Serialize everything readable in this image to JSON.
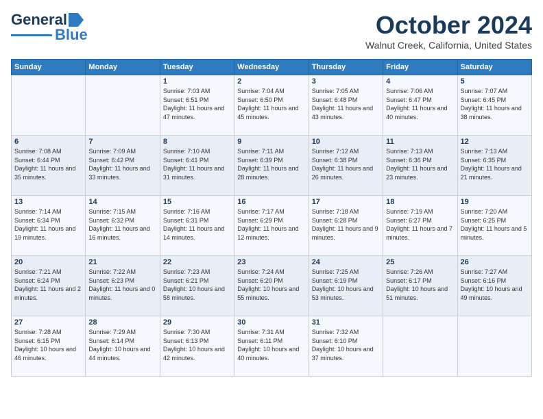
{
  "header": {
    "logo": {
      "line1": "General",
      "line2": "Blue"
    },
    "title": "October 2024",
    "location": "Walnut Creek, California, United States"
  },
  "days_of_week": [
    "Sunday",
    "Monday",
    "Tuesday",
    "Wednesday",
    "Thursday",
    "Friday",
    "Saturday"
  ],
  "weeks": [
    [
      {
        "day": "",
        "info": ""
      },
      {
        "day": "",
        "info": ""
      },
      {
        "day": "1",
        "info": "Sunrise: 7:03 AM\nSunset: 6:51 PM\nDaylight: 11 hours and 47 minutes."
      },
      {
        "day": "2",
        "info": "Sunrise: 7:04 AM\nSunset: 6:50 PM\nDaylight: 11 hours and 45 minutes."
      },
      {
        "day": "3",
        "info": "Sunrise: 7:05 AM\nSunset: 6:48 PM\nDaylight: 11 hours and 43 minutes."
      },
      {
        "day": "4",
        "info": "Sunrise: 7:06 AM\nSunset: 6:47 PM\nDaylight: 11 hours and 40 minutes."
      },
      {
        "day": "5",
        "info": "Sunrise: 7:07 AM\nSunset: 6:45 PM\nDaylight: 11 hours and 38 minutes."
      }
    ],
    [
      {
        "day": "6",
        "info": "Sunrise: 7:08 AM\nSunset: 6:44 PM\nDaylight: 11 hours and 35 minutes."
      },
      {
        "day": "7",
        "info": "Sunrise: 7:09 AM\nSunset: 6:42 PM\nDaylight: 11 hours and 33 minutes."
      },
      {
        "day": "8",
        "info": "Sunrise: 7:10 AM\nSunset: 6:41 PM\nDaylight: 11 hours and 31 minutes."
      },
      {
        "day": "9",
        "info": "Sunrise: 7:11 AM\nSunset: 6:39 PM\nDaylight: 11 hours and 28 minutes."
      },
      {
        "day": "10",
        "info": "Sunrise: 7:12 AM\nSunset: 6:38 PM\nDaylight: 11 hours and 26 minutes."
      },
      {
        "day": "11",
        "info": "Sunrise: 7:13 AM\nSunset: 6:36 PM\nDaylight: 11 hours and 23 minutes."
      },
      {
        "day": "12",
        "info": "Sunrise: 7:13 AM\nSunset: 6:35 PM\nDaylight: 11 hours and 21 minutes."
      }
    ],
    [
      {
        "day": "13",
        "info": "Sunrise: 7:14 AM\nSunset: 6:34 PM\nDaylight: 11 hours and 19 minutes."
      },
      {
        "day": "14",
        "info": "Sunrise: 7:15 AM\nSunset: 6:32 PM\nDaylight: 11 hours and 16 minutes."
      },
      {
        "day": "15",
        "info": "Sunrise: 7:16 AM\nSunset: 6:31 PM\nDaylight: 11 hours and 14 minutes."
      },
      {
        "day": "16",
        "info": "Sunrise: 7:17 AM\nSunset: 6:29 PM\nDaylight: 11 hours and 12 minutes."
      },
      {
        "day": "17",
        "info": "Sunrise: 7:18 AM\nSunset: 6:28 PM\nDaylight: 11 hours and 9 minutes."
      },
      {
        "day": "18",
        "info": "Sunrise: 7:19 AM\nSunset: 6:27 PM\nDaylight: 11 hours and 7 minutes."
      },
      {
        "day": "19",
        "info": "Sunrise: 7:20 AM\nSunset: 6:25 PM\nDaylight: 11 hours and 5 minutes."
      }
    ],
    [
      {
        "day": "20",
        "info": "Sunrise: 7:21 AM\nSunset: 6:24 PM\nDaylight: 11 hours and 2 minutes."
      },
      {
        "day": "21",
        "info": "Sunrise: 7:22 AM\nSunset: 6:23 PM\nDaylight: 11 hours and 0 minutes."
      },
      {
        "day": "22",
        "info": "Sunrise: 7:23 AM\nSunset: 6:21 PM\nDaylight: 10 hours and 58 minutes."
      },
      {
        "day": "23",
        "info": "Sunrise: 7:24 AM\nSunset: 6:20 PM\nDaylight: 10 hours and 55 minutes."
      },
      {
        "day": "24",
        "info": "Sunrise: 7:25 AM\nSunset: 6:19 PM\nDaylight: 10 hours and 53 minutes."
      },
      {
        "day": "25",
        "info": "Sunrise: 7:26 AM\nSunset: 6:17 PM\nDaylight: 10 hours and 51 minutes."
      },
      {
        "day": "26",
        "info": "Sunrise: 7:27 AM\nSunset: 6:16 PM\nDaylight: 10 hours and 49 minutes."
      }
    ],
    [
      {
        "day": "27",
        "info": "Sunrise: 7:28 AM\nSunset: 6:15 PM\nDaylight: 10 hours and 46 minutes."
      },
      {
        "day": "28",
        "info": "Sunrise: 7:29 AM\nSunset: 6:14 PM\nDaylight: 10 hours and 44 minutes."
      },
      {
        "day": "29",
        "info": "Sunrise: 7:30 AM\nSunset: 6:13 PM\nDaylight: 10 hours and 42 minutes."
      },
      {
        "day": "30",
        "info": "Sunrise: 7:31 AM\nSunset: 6:11 PM\nDaylight: 10 hours and 40 minutes."
      },
      {
        "day": "31",
        "info": "Sunrise: 7:32 AM\nSunset: 6:10 PM\nDaylight: 10 hours and 37 minutes."
      },
      {
        "day": "",
        "info": ""
      },
      {
        "day": "",
        "info": ""
      }
    ]
  ]
}
